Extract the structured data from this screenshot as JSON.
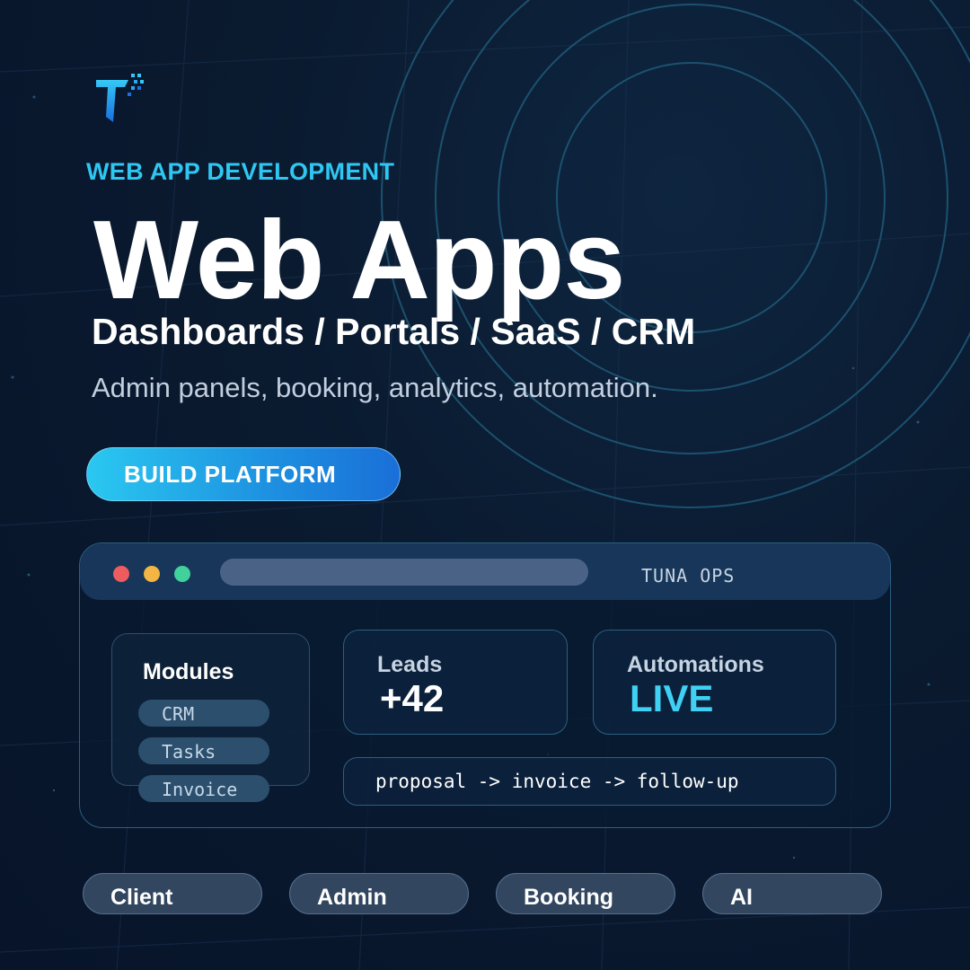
{
  "brand": {
    "logo_icon": "tuna-t-logo-icon"
  },
  "hero": {
    "eyebrow": "WEB APP DEVELOPMENT",
    "title": "Web Apps",
    "subtitle": "Dashboards / Portals / SaaS / CRM",
    "tagline": "Admin panels, booking, analytics, automation."
  },
  "cta": {
    "label": "BUILD PLATFORM"
  },
  "window": {
    "title": "TUNA OPS",
    "traffic_lights": [
      "#ee5c5f",
      "#f3b543",
      "#41d19a"
    ],
    "modules": {
      "title": "Modules",
      "items": [
        "CRM",
        "Tasks",
        "Invoice"
      ]
    },
    "leads": {
      "label": "Leads",
      "value": "+42"
    },
    "automations": {
      "label": "Automations",
      "value": "LIVE"
    },
    "flow": "proposal -> invoice -> follow-up"
  },
  "tags": [
    "Client",
    "Admin",
    "Booking",
    "AI"
  ],
  "colors": {
    "accent": "#2fc7f2",
    "background": "#0a1a2f",
    "live": "#3fd0f4"
  }
}
